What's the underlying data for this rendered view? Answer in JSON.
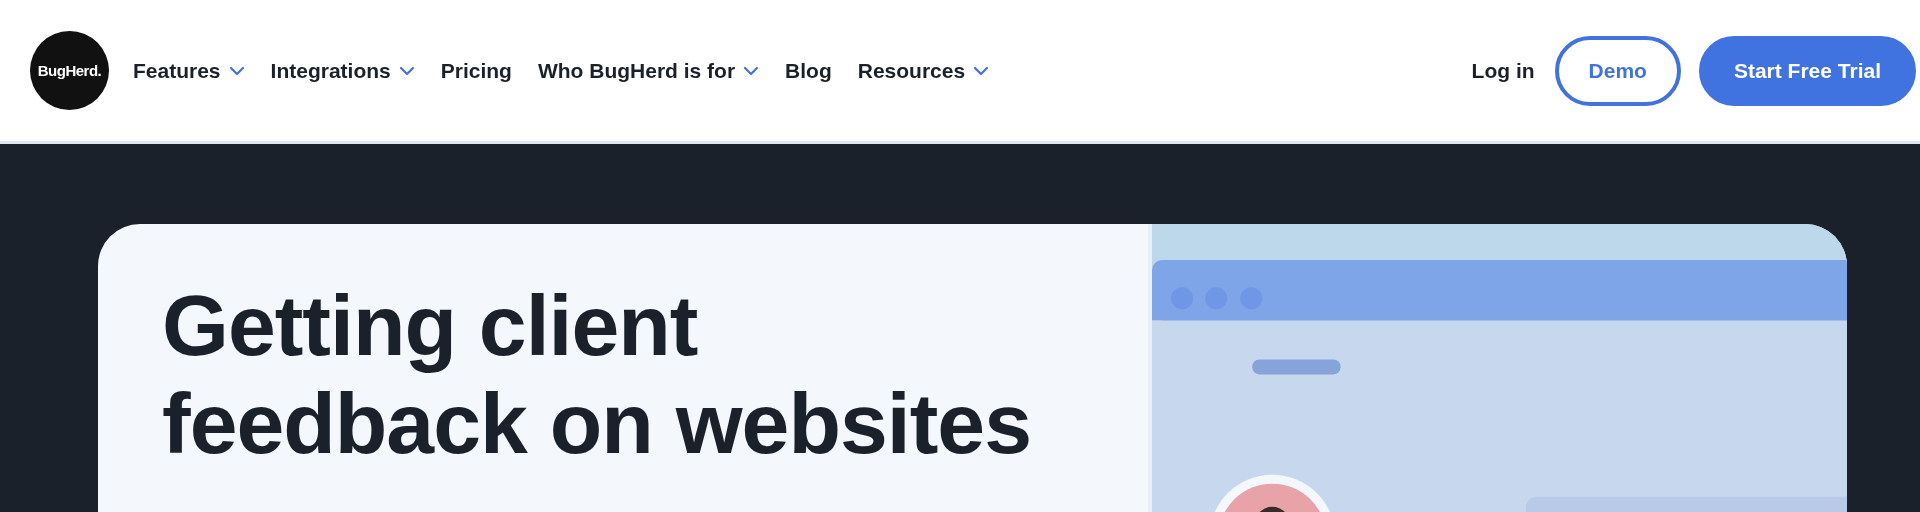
{
  "logo": {
    "text": "BugHerd."
  },
  "nav": [
    {
      "label": "Features",
      "has_dropdown": true
    },
    {
      "label": "Integrations",
      "has_dropdown": true
    },
    {
      "label": "Pricing",
      "has_dropdown": false
    },
    {
      "label": "Who BugHerd is for",
      "has_dropdown": true
    },
    {
      "label": "Blog",
      "has_dropdown": false
    },
    {
      "label": "Resources",
      "has_dropdown": true
    }
  ],
  "actions": [
    {
      "label": "Log in",
      "kind": "link"
    },
    {
      "label": "Demo",
      "kind": "outline"
    },
    {
      "label": "Start Free Trial",
      "kind": "primary"
    }
  ],
  "hero": {
    "heading": [
      "Getting client",
      "feedback on websites"
    ]
  }
}
